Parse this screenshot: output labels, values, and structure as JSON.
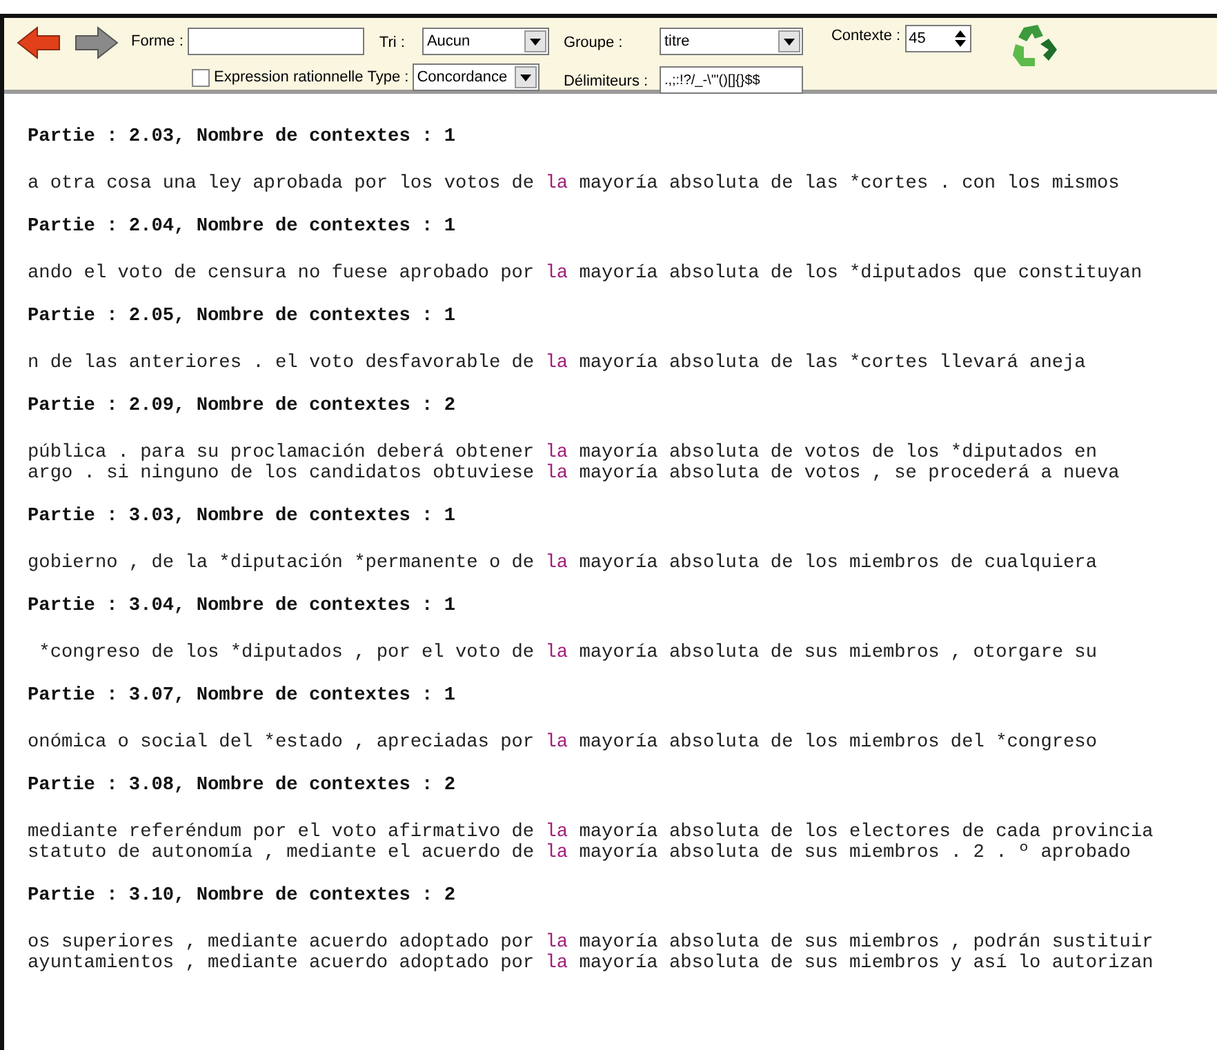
{
  "toolbar": {
    "forme": {
      "label": "Forme :"
    },
    "regex": {
      "label": "Expression rationnelle",
      "checked": false
    },
    "tri": {
      "label": "Tri :",
      "value": "Aucun"
    },
    "type": {
      "label": "Type :",
      "value": "Concordance"
    },
    "groupe": {
      "label": "Groupe :",
      "value": "titre"
    },
    "delimiteurs": {
      "label": "Délimiteurs :",
      "value": ".,;:!?/_-\\'\"()[]{}$$"
    },
    "contexte": {
      "label": "Contexte :",
      "value": "45"
    }
  },
  "parts": [
    {
      "header": "Partie : 2.03, Nombre de contextes : 1",
      "lines": [
        {
          "left": "a otra cosa una ley aprobada por los votos de ",
          "keyword": "la",
          "right": " mayoría absoluta de las *cortes . con los mismos"
        }
      ]
    },
    {
      "header": "Partie : 2.04, Nombre de contextes : 1",
      "lines": [
        {
          "left": "ando el voto de censura no fuese aprobado por ",
          "keyword": "la",
          "right": " mayoría absoluta de los *diputados que constituyan"
        }
      ]
    },
    {
      "header": "Partie : 2.05, Nombre de contextes : 1",
      "lines": [
        {
          "left": "n de las anteriores . el voto desfavorable de ",
          "keyword": "la",
          "right": " mayoría absoluta de las *cortes llevará aneja"
        }
      ]
    },
    {
      "header": "Partie : 2.09, Nombre de contextes : 2",
      "lines": [
        {
          "left": "pública . para su proclamación deberá obtener ",
          "keyword": "la",
          "right": " mayoría absoluta de votos de los *diputados en"
        },
        {
          "left": "argo . si ninguno de los candidatos obtuviese ",
          "keyword": "la",
          "right": " mayoría absoluta de votos , se procederá a nueva"
        }
      ]
    },
    {
      "header": "Partie : 3.03, Nombre de contextes : 1",
      "lines": [
        {
          "left": "gobierno , de la *diputación *permanente o de ",
          "keyword": "la",
          "right": " mayoría absoluta de los miembros de cualquiera"
        }
      ]
    },
    {
      "header": "Partie : 3.04, Nombre de contextes : 1",
      "lines": [
        {
          "left": " *congreso de los *diputados , por el voto de ",
          "keyword": "la",
          "right": " mayoría absoluta de sus miembros , otorgare su"
        }
      ]
    },
    {
      "header": "Partie : 3.07, Nombre de contextes : 1",
      "lines": [
        {
          "left": "onómica o social del *estado , apreciadas por ",
          "keyword": "la",
          "right": " mayoría absoluta de los miembros del *congreso"
        }
      ]
    },
    {
      "header": "Partie : 3.08, Nombre de contextes : 2",
      "lines": [
        {
          "left": "mediante referéndum por el voto afirmativo de ",
          "keyword": "la",
          "right": " mayoría absoluta de los electores de cada provincia"
        },
        {
          "left": "statuto de autonomía , mediante el acuerdo de ",
          "keyword": "la",
          "right": " mayoría absoluta de sus miembros . 2 . º aprobado"
        }
      ]
    },
    {
      "header": "Partie : 3.10, Nombre de contextes : 2",
      "lines": [
        {
          "left": "os superiores , mediante acuerdo adoptado por ",
          "keyword": "la",
          "right": " mayoría absoluta de sus miembros , podrán sustituir"
        },
        {
          "left": "ayuntamientos , mediante acuerdo adoptado por ",
          "keyword": "la",
          "right": " mayoría absoluta de sus miembros y así lo autorizan"
        }
      ]
    }
  ]
}
